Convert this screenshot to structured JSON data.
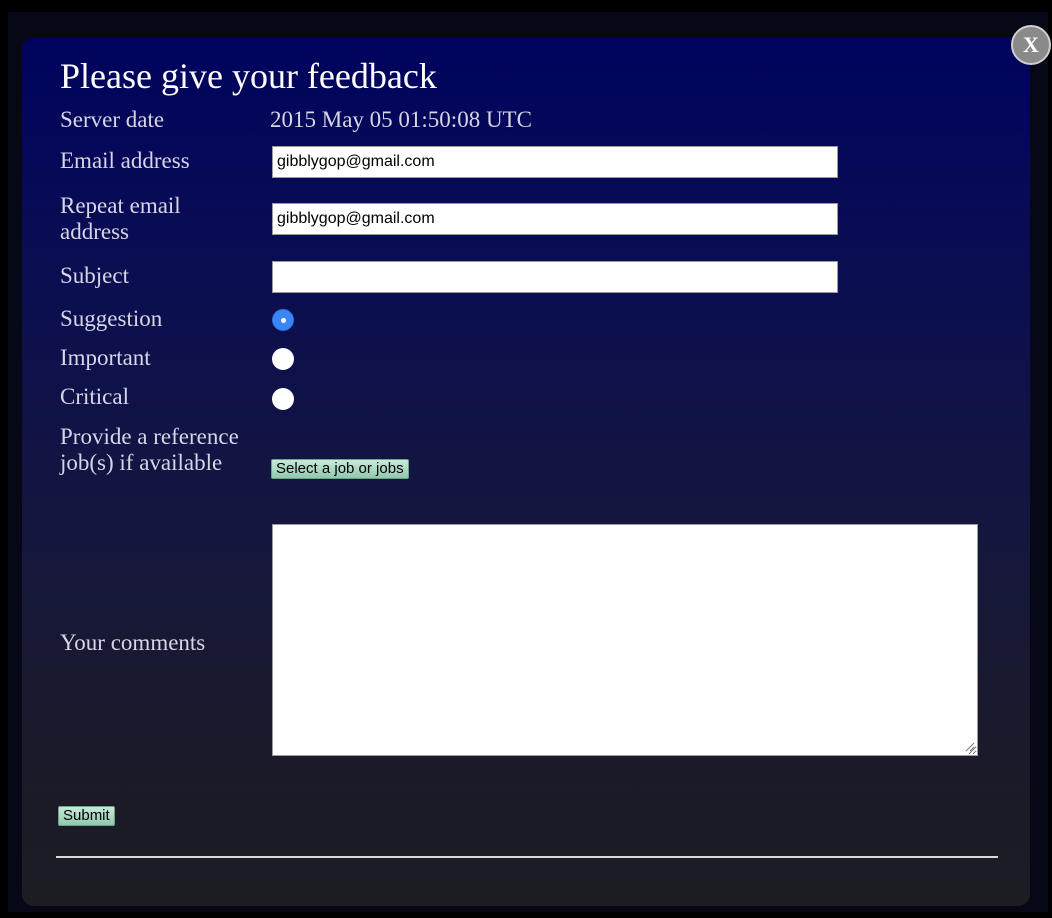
{
  "dialog": {
    "title": "Please give your feedback",
    "close_label": "X"
  },
  "form": {
    "server_date": {
      "label": "Server date",
      "value": "2015 May 05 01:50:08 UTC"
    },
    "email": {
      "label": "Email address",
      "value": "gibblygop@gmail.com"
    },
    "repeat_email": {
      "label": "Repeat email address",
      "value": "gibblygop@gmail.com"
    },
    "subject": {
      "label": "Subject",
      "value": ""
    },
    "priority": {
      "selected": "Suggestion",
      "options": [
        {
          "label": "Suggestion",
          "checked": true
        },
        {
          "label": "Important",
          "checked": false
        },
        {
          "label": "Critical",
          "checked": false
        }
      ]
    },
    "reference_jobs": {
      "label": "Provide a reference job(s) if available",
      "button_label": "Select a job or jobs"
    },
    "comments": {
      "label": "Your comments",
      "value": ""
    },
    "submit_label": "Submit"
  },
  "colors": {
    "dialog_top": "#00035e",
    "dialog_bottom": "#1c1c22",
    "label_text": "#d6d6e6",
    "radio_selected": "#3b86f7",
    "button_bg": "#a8d9c0"
  }
}
